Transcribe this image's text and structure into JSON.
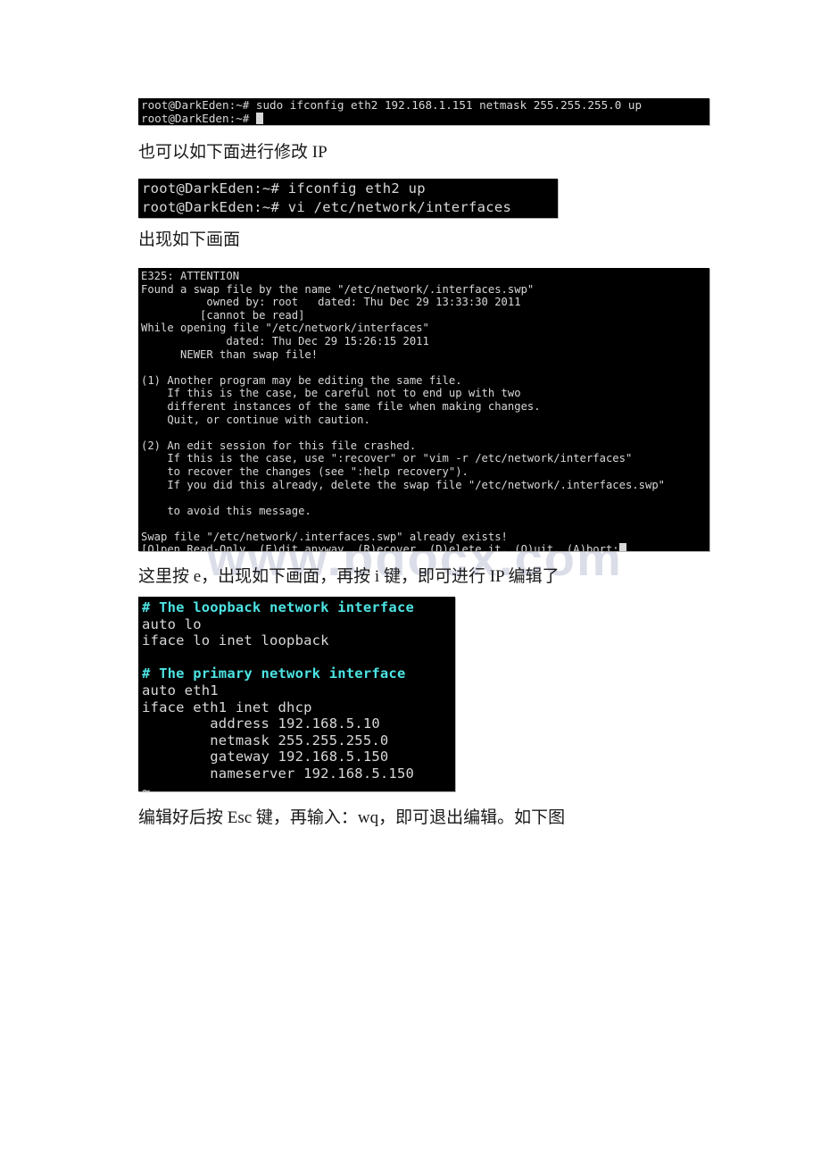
{
  "document": {
    "watermark": "www.bdocx.com"
  },
  "paragraphs": [
    {
      "id": "p1",
      "text": "也可以如下面进行修改 IP"
    },
    {
      "id": "p2",
      "text": "出现如下画面"
    },
    {
      "id": "p3",
      "text": "这里按 e，出现如下画面，再按 i 键，即可进行 IP 编辑了"
    },
    {
      "id": "p4",
      "text": "编辑好后按 Esc 键，再输入：wq，即可退出编辑。如下图"
    }
  ],
  "terminals": {
    "ifconfig_sudo": {
      "title": "terminal-sudo-ifconfig",
      "lines": [
        "root@DarkEden:~# sudo ifconfig eth2 192.168.1.151 netmask 255.255.255.0 up",
        "root@DarkEden:~# "
      ]
    },
    "ifconfig_vi": {
      "title": "terminal-ifconfig-up-vi",
      "lines": [
        "root@DarkEden:~# ifconfig eth2 up",
        "root@DarkEden:~# vi /etc/network/interfaces"
      ]
    },
    "swap_warning": {
      "title": "vim-swap-file-warning",
      "lines": [
        "E325: ATTENTION",
        "Found a swap file by the name \"/etc/network/.interfaces.swp\"",
        "          owned by: root   dated: Thu Dec 29 13:33:30 2011",
        "         [cannot be read]",
        "While opening file \"/etc/network/interfaces\"",
        "             dated: Thu Dec 29 15:26:15 2011",
        "      NEWER than swap file!",
        "",
        "(1) Another program may be editing the same file.",
        "    If this is the case, be careful not to end up with two",
        "    different instances of the same file when making changes.",
        "    Quit, or continue with caution.",
        "",
        "(2) An edit session for this file crashed.",
        "    If this is the case, use \":recover\" or \"vim -r /etc/network/interfaces\"",
        "    to recover the changes (see \":help recovery\").",
        "    If you did this already, delete the swap file \"/etc/network/.interfaces.swp\"",
        "",
        "    to avoid this message.",
        "",
        "Swap file \"/etc/network/.interfaces.swp\" already exists!"
      ],
      "prompt": "[O]pen Read-Only, (E)dit anyway, (R)ecover, (D)elete it, (Q)uit, (A)bort:"
    },
    "vim_interfaces": {
      "title": "vim-etc-network-interfaces",
      "lines": [
        {
          "text": "# The loopback network interface",
          "style": "comment"
        },
        {
          "text": "auto lo",
          "style": "text"
        },
        {
          "text": "iface lo inet loopback",
          "style": "text"
        },
        {
          "text": "",
          "style": "text"
        },
        {
          "text": "# The primary network interface",
          "style": "comment"
        },
        {
          "text": "auto eth1",
          "style": "text"
        },
        {
          "text": "iface eth1 inet dhcp",
          "style": "text"
        },
        {
          "text": "        address 192.168.5.10",
          "style": "text"
        },
        {
          "text": "        netmask 255.255.255.0",
          "style": "text"
        },
        {
          "text": "        gateway 192.168.5.150",
          "style": "text"
        },
        {
          "text": "        nameserver 192.168.5.150",
          "style": "text"
        }
      ],
      "tilde_marker": "~"
    }
  },
  "colors": {
    "terminal_background": "#000000",
    "terminal_foreground": "#d8d8d8",
    "vim_comment": "#4de3e3",
    "vim_tilde": "#3b3fa0",
    "page_background": "#ffffff",
    "watermark": "#d5d9e4"
  }
}
